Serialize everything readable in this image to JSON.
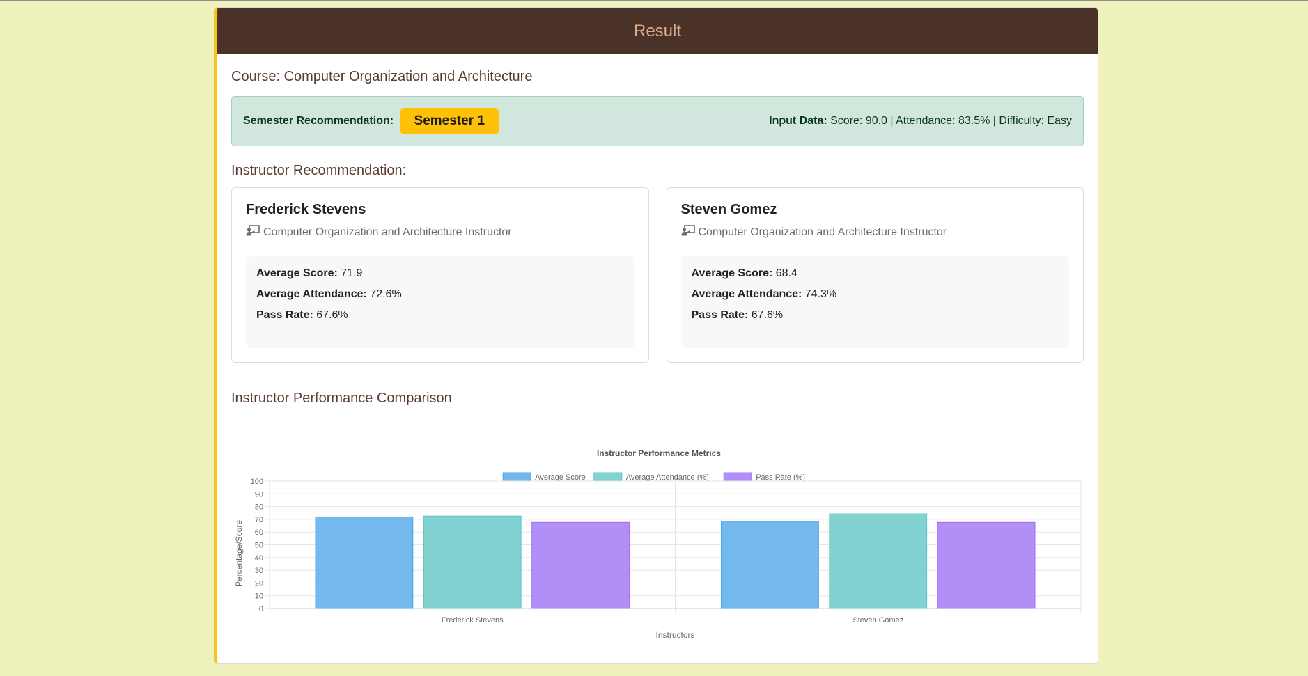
{
  "header": {
    "title": "Result"
  },
  "course": {
    "label": "Course: Computer Organization and Architecture"
  },
  "semester": {
    "label": "Semester Recommendation:",
    "value": "Semester 1",
    "input_label": "Input Data:",
    "input_text": " Score: 90.0 | Attendance: 83.5% | Difficulty: Easy"
  },
  "instructor_section": {
    "title": "Instructor Recommendation:"
  },
  "instructors": [
    {
      "name": "Frederick Stevens",
      "role": "Computer Organization and Architecture Instructor",
      "score_label": "Average Score:",
      "score": " 71.9",
      "attendance_label": "Average Attendance:",
      "attendance": " 72.6%",
      "pass_label": "Pass Rate:",
      "pass": " 67.6%"
    },
    {
      "name": "Steven Gomez",
      "role": "Computer Organization and Architecture Instructor",
      "score_label": "Average Score:",
      "score": " 68.4",
      "attendance_label": "Average Attendance:",
      "attendance": " 74.3%",
      "pass_label": "Pass Rate:",
      "pass": " 67.6%"
    }
  ],
  "comparison": {
    "title": "Instructor Performance Comparison"
  },
  "chart_data": {
    "type": "bar",
    "title": "Instructor Performance Metrics",
    "xlabel": "Instructors",
    "ylabel": "Percentage/Score",
    "categories": [
      "Frederick Stevens",
      "Steven Gomez"
    ],
    "ylim": [
      0,
      100
    ],
    "yticks": [
      0,
      10,
      20,
      30,
      40,
      50,
      60,
      70,
      80,
      90,
      100
    ],
    "grid": true,
    "legend_position": "top",
    "series": [
      {
        "name": "Average Score",
        "values": [
          71.9,
          68.4
        ],
        "color": "#74b9ee",
        "border": "#4aa3e6"
      },
      {
        "name": "Average Attendance (%)",
        "values": [
          72.6,
          74.3
        ],
        "color": "#82d2d2",
        "border": "#5fc4c4"
      },
      {
        "name": "Pass Rate (%)",
        "values": [
          67.6,
          67.6
        ],
        "color": "#b28ff7",
        "border": "#9e73f5"
      }
    ]
  },
  "colors": {
    "header_bg": "#4a3229",
    "header_text": "#d8a98c",
    "accent": "#f5c518",
    "badge": "#ffc107",
    "page_bg": "#f0f2bd"
  },
  "icons": {
    "instructor": "chalkboard-teacher-icon"
  }
}
